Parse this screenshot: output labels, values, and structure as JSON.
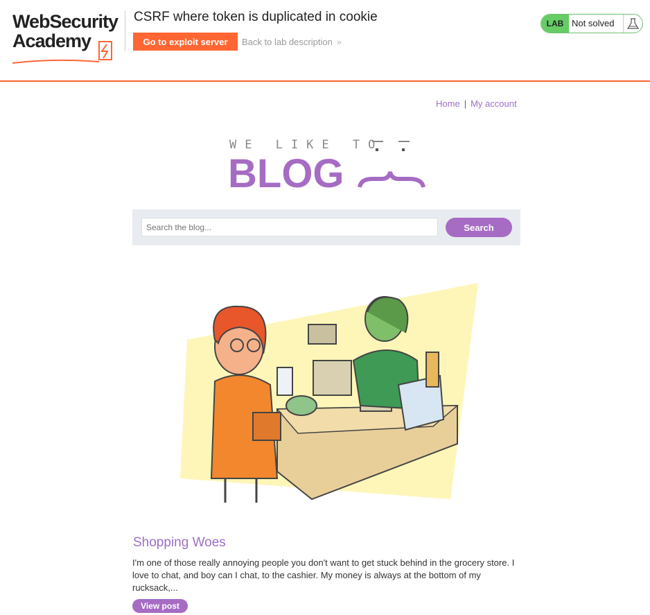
{
  "header": {
    "logo_line1": "WebSecurity",
    "logo_line2": "Academy",
    "lab_title": "CSRF where token is duplicated in cookie",
    "exploit_button": "Go to exploit server",
    "back_link": "Back to lab description",
    "back_chevron": "»",
    "status": {
      "lab_badge": "LAB",
      "text": "Not solved",
      "icon": "flask-icon"
    }
  },
  "nav": {
    "home": "Home",
    "separator": "|",
    "account": "My account"
  },
  "blog_logo": {
    "top_text": "WE LIKE TO",
    "main_text": "BLOG"
  },
  "search": {
    "placeholder": "Search the blog...",
    "button": "Search"
  },
  "post": {
    "title": "Shopping Woes",
    "excerpt": "I'm one of those really annoying people you don't want to get stuck behind in the grocery store. I love to chat, and boy can I chat, to the cashier. My money is always at the bottom of my rucksack,...",
    "button": "View post"
  },
  "colors": {
    "accent": "#ff6633",
    "purple": "#a66cc4",
    "lab_green": "#66cc66"
  }
}
